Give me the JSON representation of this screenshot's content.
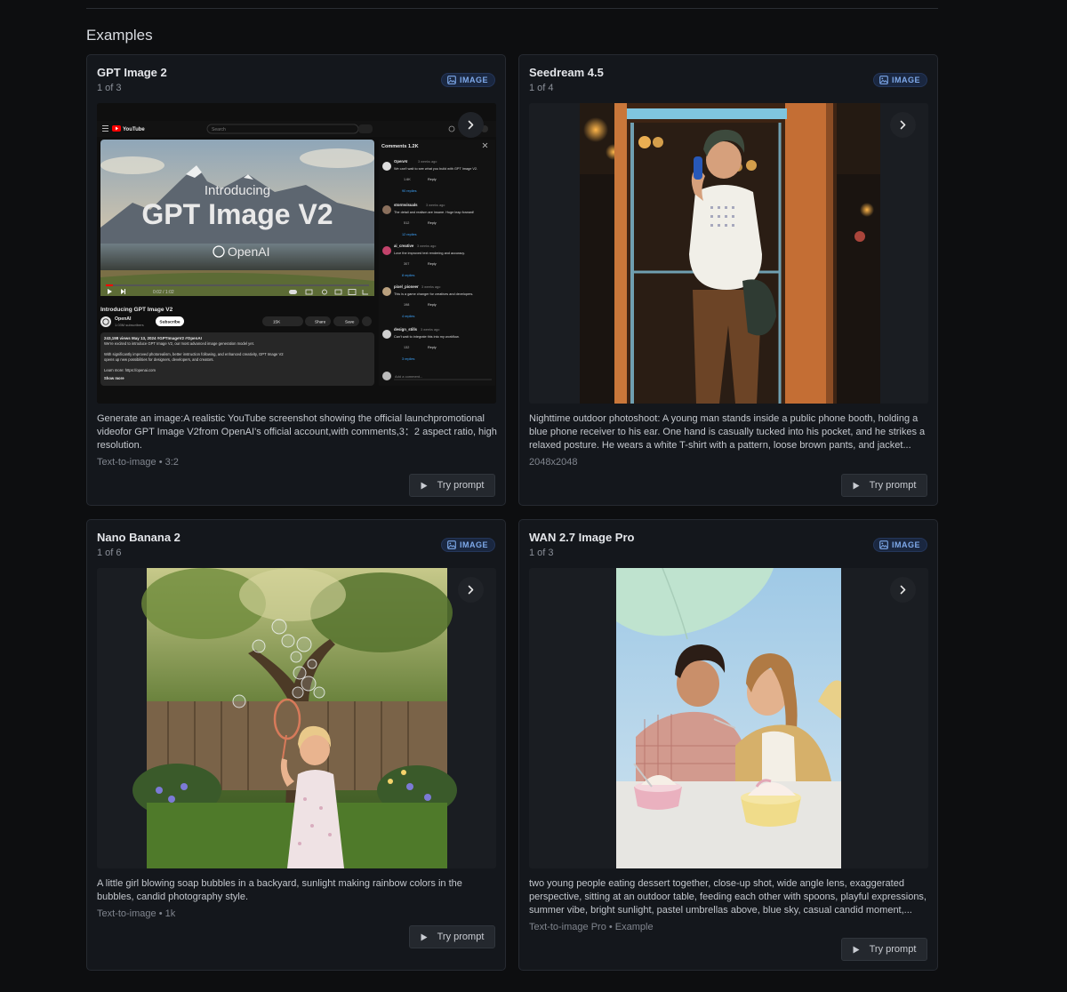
{
  "section": {
    "title": "Examples"
  },
  "icons": {
    "badge": "image-icon",
    "next": "chevron-right-icon",
    "try": "play-icon"
  },
  "colors": {
    "accent_badge": "#7ea9ea",
    "background": "#0d0e10",
    "card": "#14171c"
  },
  "cards": [
    {
      "title": "GPT Image 2",
      "counter": "1 of 3",
      "badge": "IMAGE",
      "prompt": "Generate an image:A realistic YouTube screenshot showing the official launchpromotional videofor GPT Image V2from OpenAI's official account,with comments,3：2 aspect ratio, high resolution.",
      "meta": "Text-to-image • 3:2",
      "try_label": "Try prompt",
      "mock": {
        "brand": "YouTube",
        "search": "Search",
        "video_kicker": "Introducing",
        "video_title": "GPT Image V2",
        "video_brand": "OpenAI",
        "time": "0:02 / 1:02",
        "title_below": "Introducing GPT Image V2",
        "channel": "OpenAI",
        "subscribers": "1.03M subscribers",
        "subscribe": "Subscribe",
        "likes": "15K",
        "share": "Share",
        "save": "Save",
        "views": "243,198 views  May 13, 2024  #GPTImageV2 #OpenAI",
        "desc1": "We're excited to introduce GPT Image V2, our most advanced image generation model yet.",
        "desc2": "With significantly improved photorealism, better instruction following, and enhanced creativity, GPT Image V2",
        "desc3": "opens up new possibilities for designers, developers, and creators.",
        "learn_more": "Learn more: https://openai.com",
        "show_more": "Show more",
        "comments_header": "Comments  1.2K",
        "add_comment": "Add a comment...",
        "comments": [
          {
            "user": "OpenAI",
            "when": "3 weeks ago",
            "text": "We can't wait to see what you build with GPT Image V2.",
            "likes": "1.6K",
            "replies": "90 replies"
          },
          {
            "user": "stormvisuals",
            "when": "3 weeks ago",
            "text": "The detail and realism are insane. Huge leap forward!",
            "likes": "512",
            "replies": "12 replies"
          },
          {
            "user": "ai_creative",
            "when": "3 weeks ago",
            "text": "Love the improved text rendering and accuracy.",
            "likes": "307",
            "replies": "8 replies"
          },
          {
            "user": "pixel_pioneer",
            "when": "3 weeks ago",
            "text": "This is a game changer for creatives and developers.",
            "likes": "198",
            "replies": "4 replies"
          },
          {
            "user": "design_stills",
            "when": "3 weeks ago",
            "text": "Can't wait to integrate this into my workflow.",
            "likes": "132",
            "replies": "3 replies"
          }
        ],
        "reply_label": "Reply"
      }
    },
    {
      "title": "Seedream 4.5",
      "counter": "1 of 4",
      "badge": "IMAGE",
      "prompt": "Nighttime outdoor photoshoot: A young man stands inside a public phone booth, holding a blue phone receiver to his ear. One hand is casually tucked into his pocket, and he strikes a relaxed posture. He wears a white T-shirt with a pattern, loose brown pants, and jacket...",
      "meta": "2048x2048",
      "try_label": "Try prompt"
    },
    {
      "title": "Nano Banana 2",
      "counter": "1 of 6",
      "badge": "IMAGE",
      "prompt": "A little girl blowing soap bubbles in a backyard, sunlight making rainbow colors in the bubbles, candid photography style.",
      "meta": "Text-to-image • 1k",
      "try_label": "Try prompt"
    },
    {
      "title": "WAN 2.7 Image Pro",
      "counter": "1 of 3",
      "badge": "IMAGE",
      "prompt": "two young people eating dessert together, close-up shot, wide angle lens, exaggerated perspective, sitting at an outdoor table, feeding each other with spoons, playful expressions, summer vibe, bright sunlight, pastel umbrellas above, blue sky, casual candid moment,...",
      "meta": "Text-to-image Pro • Example",
      "try_label": "Try prompt"
    }
  ]
}
